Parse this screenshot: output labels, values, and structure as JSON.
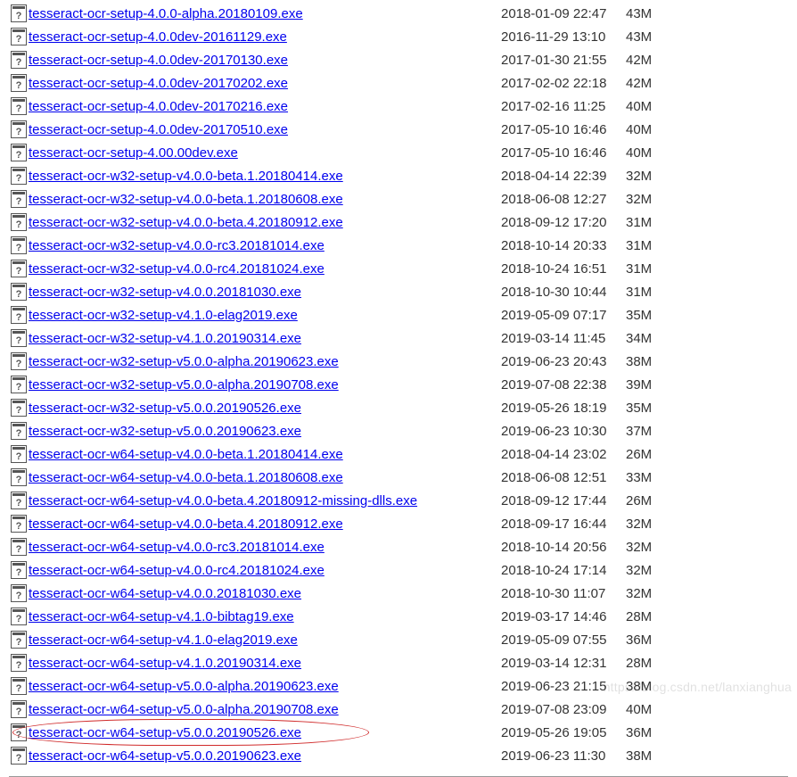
{
  "watermark": "https://blog.csdn.net/lanxianghua",
  "highlight_index": 31,
  "files": [
    {
      "name": "tesseract-ocr-setup-4.0.0-alpha.20180109.exe",
      "date": "2018-01-09 22:47",
      "size": "43M"
    },
    {
      "name": "tesseract-ocr-setup-4.0.0dev-20161129.exe",
      "date": "2016-11-29 13:10",
      "size": "43M"
    },
    {
      "name": "tesseract-ocr-setup-4.0.0dev-20170130.exe",
      "date": "2017-01-30 21:55",
      "size": "42M"
    },
    {
      "name": "tesseract-ocr-setup-4.0.0dev-20170202.exe",
      "date": "2017-02-02 22:18",
      "size": "42M"
    },
    {
      "name": "tesseract-ocr-setup-4.0.0dev-20170216.exe",
      "date": "2017-02-16 11:25",
      "size": "40M"
    },
    {
      "name": "tesseract-ocr-setup-4.0.0dev-20170510.exe",
      "date": "2017-05-10 16:46",
      "size": "40M"
    },
    {
      "name": "tesseract-ocr-setup-4.00.00dev.exe",
      "date": "2017-05-10 16:46",
      "size": "40M"
    },
    {
      "name": "tesseract-ocr-w32-setup-v4.0.0-beta.1.20180414.exe",
      "date": "2018-04-14 22:39",
      "size": "32M"
    },
    {
      "name": "tesseract-ocr-w32-setup-v4.0.0-beta.1.20180608.exe",
      "date": "2018-06-08 12:27",
      "size": "32M"
    },
    {
      "name": "tesseract-ocr-w32-setup-v4.0.0-beta.4.20180912.exe",
      "date": "2018-09-12 17:20",
      "size": "31M"
    },
    {
      "name": "tesseract-ocr-w32-setup-v4.0.0-rc3.20181014.exe",
      "date": "2018-10-14 20:33",
      "size": "31M"
    },
    {
      "name": "tesseract-ocr-w32-setup-v4.0.0-rc4.20181024.exe",
      "date": "2018-10-24 16:51",
      "size": "31M"
    },
    {
      "name": "tesseract-ocr-w32-setup-v4.0.0.20181030.exe",
      "date": "2018-10-30 10:44",
      "size": "31M"
    },
    {
      "name": "tesseract-ocr-w32-setup-v4.1.0-elag2019.exe",
      "date": "2019-05-09 07:17",
      "size": "35M"
    },
    {
      "name": "tesseract-ocr-w32-setup-v4.1.0.20190314.exe",
      "date": "2019-03-14 11:45",
      "size": "34M"
    },
    {
      "name": "tesseract-ocr-w32-setup-v5.0.0-alpha.20190623.exe",
      "date": "2019-06-23 20:43",
      "size": "38M"
    },
    {
      "name": "tesseract-ocr-w32-setup-v5.0.0-alpha.20190708.exe",
      "date": "2019-07-08 22:38",
      "size": "39M"
    },
    {
      "name": "tesseract-ocr-w32-setup-v5.0.0.20190526.exe",
      "date": "2019-05-26 18:19",
      "size": "35M"
    },
    {
      "name": "tesseract-ocr-w32-setup-v5.0.0.20190623.exe",
      "date": "2019-06-23 10:30",
      "size": "37M"
    },
    {
      "name": "tesseract-ocr-w64-setup-v4.0.0-beta.1.20180414.exe",
      "date": "2018-04-14 23:02",
      "size": "26M"
    },
    {
      "name": "tesseract-ocr-w64-setup-v4.0.0-beta.1.20180608.exe",
      "date": "2018-06-08 12:51",
      "size": "33M"
    },
    {
      "name": "tesseract-ocr-w64-setup-v4.0.0-beta.4.20180912-missing-dlls.exe",
      "date": "2018-09-12 17:44",
      "size": "26M"
    },
    {
      "name": "tesseract-ocr-w64-setup-v4.0.0-beta.4.20180912.exe",
      "date": "2018-09-17 16:44",
      "size": "32M"
    },
    {
      "name": "tesseract-ocr-w64-setup-v4.0.0-rc3.20181014.exe",
      "date": "2018-10-14 20:56",
      "size": "32M"
    },
    {
      "name": "tesseract-ocr-w64-setup-v4.0.0-rc4.20181024.exe",
      "date": "2018-10-24 17:14",
      "size": "32M"
    },
    {
      "name": "tesseract-ocr-w64-setup-v4.0.0.20181030.exe",
      "date": "2018-10-30 11:07",
      "size": "32M"
    },
    {
      "name": "tesseract-ocr-w64-setup-v4.1.0-bibtag19.exe",
      "date": "2019-03-17 14:46",
      "size": "28M"
    },
    {
      "name": "tesseract-ocr-w64-setup-v4.1.0-elag2019.exe",
      "date": "2019-05-09 07:55",
      "size": "36M"
    },
    {
      "name": "tesseract-ocr-w64-setup-v4.1.0.20190314.exe",
      "date": "2019-03-14 12:31",
      "size": "28M"
    },
    {
      "name": "tesseract-ocr-w64-setup-v5.0.0-alpha.20190623.exe",
      "date": "2019-06-23 21:15",
      "size": "38M"
    },
    {
      "name": "tesseract-ocr-w64-setup-v5.0.0-alpha.20190708.exe",
      "date": "2019-07-08 23:09",
      "size": "40M"
    },
    {
      "name": "tesseract-ocr-w64-setup-v5.0.0.20190526.exe",
      "date": "2019-05-26 19:05",
      "size": "36M"
    },
    {
      "name": "tesseract-ocr-w64-setup-v5.0.0.20190623.exe",
      "date": "2019-06-23 11:30",
      "size": "38M"
    }
  ]
}
